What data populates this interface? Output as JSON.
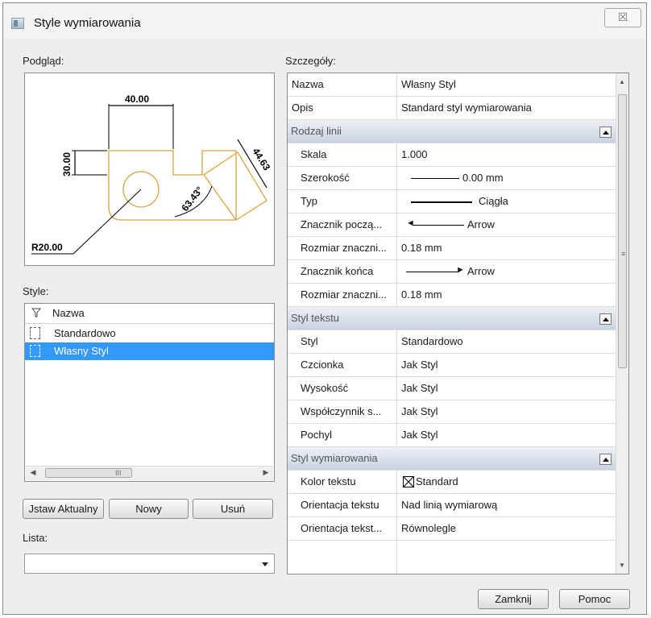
{
  "window": {
    "title": "Style wymiarowania",
    "close_glyph": "☒"
  },
  "preview": {
    "label": "Podgląd:",
    "drawing": {
      "dim_top": "40.00",
      "dim_left": "30.00",
      "dim_right": "44.63",
      "dim_angle": "63.43°",
      "dim_radius": "R20.00"
    }
  },
  "styles": {
    "label": "Style:",
    "header": "Nazwa",
    "items": [
      {
        "label": "Standardowo",
        "selected": false
      },
      {
        "label": "Własny Styl",
        "selected": true
      }
    ],
    "scroll_grip": "III"
  },
  "buttons": {
    "set_current": "Jstaw Aktualny",
    "new": "Nowy",
    "delete": "Usuń",
    "close": "Zamknij",
    "help": "Pomoc"
  },
  "list": {
    "label": "Lista:",
    "value": ""
  },
  "details": {
    "label": "Szczegóły:",
    "rows": [
      {
        "name": "Nazwa",
        "value": "Własny Styl"
      },
      {
        "name": "Opis",
        "value": "Standard styl wymiarowania"
      }
    ],
    "sections": [
      {
        "title": "Rodzaj linii",
        "rows": [
          {
            "name": "Skala",
            "value": "1.000"
          },
          {
            "name": "Szerokość",
            "value": "0.00 mm"
          },
          {
            "name": "Typ",
            "value": "Ciągła"
          },
          {
            "name": "Znacznik począ...",
            "value": "Arrow"
          },
          {
            "name": "Rozmiar znaczni...",
            "value": "0.18 mm"
          },
          {
            "name": "Znacznik końca",
            "value": "Arrow"
          },
          {
            "name": "Rozmiar znaczni...",
            "value": "0.18 mm"
          }
        ]
      },
      {
        "title": "Styl tekstu",
        "rows": [
          {
            "name": "Styl",
            "value": "Standardowo"
          },
          {
            "name": "Czcionka",
            "value": "Jak Styl"
          },
          {
            "name": "Wysokość",
            "value": "Jak Styl"
          },
          {
            "name": "Współczynnik s...",
            "value": "Jak Styl"
          },
          {
            "name": "Pochyl",
            "value": "Jak Styl"
          }
        ]
      },
      {
        "title": "Styl wymiarowania",
        "rows": [
          {
            "name": "Kolor tekstu",
            "value": "Standard"
          },
          {
            "name": "Orientacja tekstu",
            "value": "Nad linią wymiarową"
          },
          {
            "name": "Orientacja tekst...",
            "value": "Równolegle"
          }
        ]
      }
    ]
  },
  "colors": {
    "drawing_outline": "#d9a441",
    "selection": "#3399ff",
    "section_header": "#c7d3e1"
  }
}
